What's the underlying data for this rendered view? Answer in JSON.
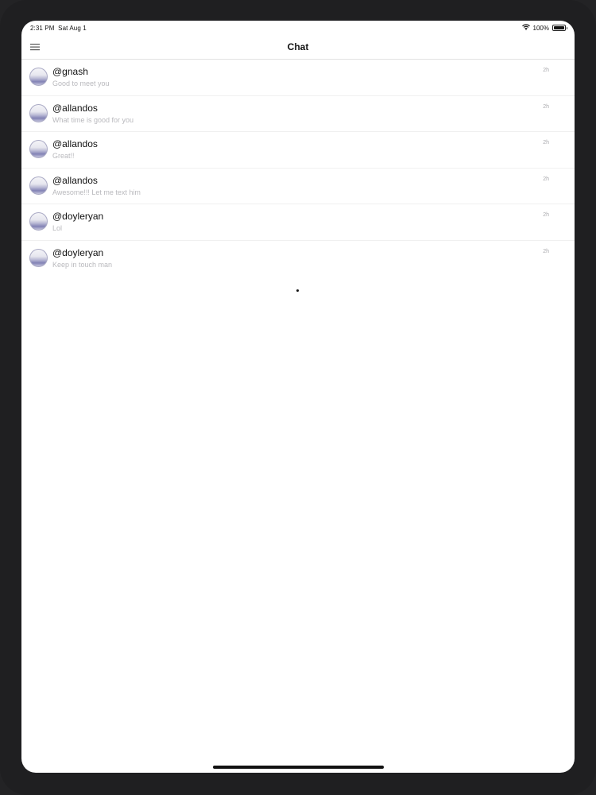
{
  "status_bar": {
    "time": "2:31 PM",
    "date": "Sat Aug 1",
    "battery": "100%",
    "battery_level": 1.0,
    "wifi_icon": "wifi-icon",
    "battery_icon": "battery-icon"
  },
  "nav": {
    "title": "Chat",
    "menu_icon": "hamburger-menu-icon"
  },
  "chats": [
    {
      "name": "@gnash",
      "preview": "Good to meet you",
      "time": "2h"
    },
    {
      "name": "@allandos",
      "preview": "What time is good for you",
      "time": "2h"
    },
    {
      "name": "@allandos",
      "preview": "Great!!",
      "time": "2h"
    },
    {
      "name": "@allandos",
      "preview": "Awesome!!! Let me text him",
      "time": "2h"
    },
    {
      "name": "@doyleryan",
      "preview": "Lol",
      "time": "2h"
    },
    {
      "name": "@doyleryan",
      "preview": "Keep in touch man",
      "time": "2h"
    }
  ],
  "colors": {
    "accent_text": "#111111",
    "secondary_text": "#b9b9bd",
    "avatar_tint": "#8282b5"
  }
}
